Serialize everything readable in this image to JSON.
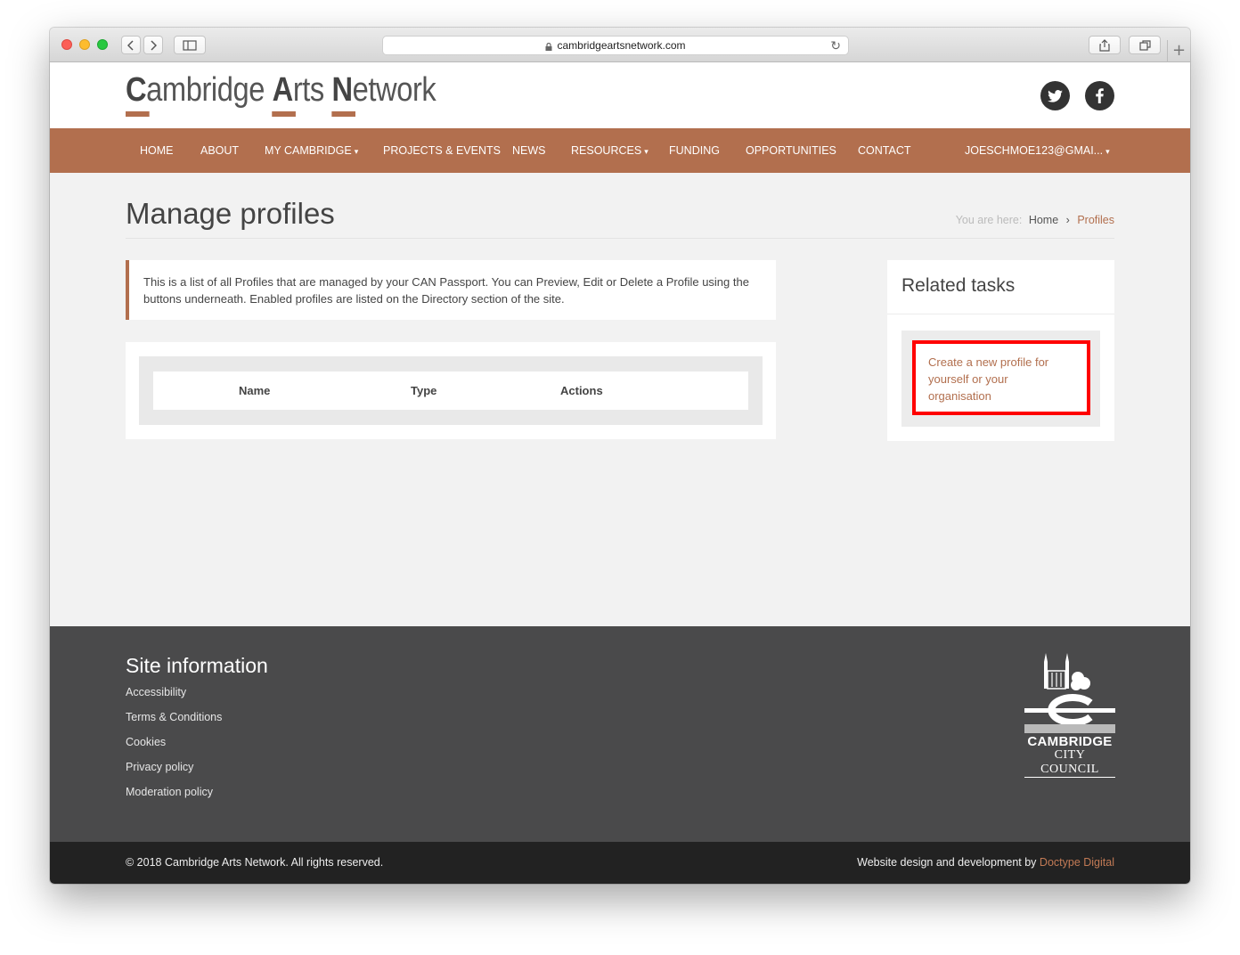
{
  "browser": {
    "url": "cambridgeartsnetwork.com"
  },
  "site": {
    "logo": {
      "c": "C",
      "ambridge": "ambridge",
      "a": "A",
      "rts": "rts",
      "n": "N",
      "etwork": "etwork"
    },
    "social": [
      {
        "icon": "twitter-icon"
      },
      {
        "icon": "facebook-icon"
      }
    ]
  },
  "nav": {
    "items": [
      {
        "label": "HOME",
        "dropdown": false
      },
      {
        "label": "ABOUT",
        "dropdown": false
      },
      {
        "label": "MY CAMBRIDGE",
        "dropdown": true
      },
      {
        "label": "PROJECTS & EVENTS",
        "dropdown": false
      },
      {
        "label": "NEWS",
        "dropdown": false
      },
      {
        "label": "RESOURCES",
        "dropdown": true
      },
      {
        "label": "FUNDING",
        "dropdown": false
      },
      {
        "label": "OPPORTUNITIES",
        "dropdown": false
      },
      {
        "label": "CONTACT",
        "dropdown": false
      }
    ],
    "account": "JOESCHMOE123@GMAI..."
  },
  "page": {
    "title": "Manage profiles",
    "breadcrumb": {
      "label": "You are here:",
      "home": "Home",
      "separator": "›",
      "current": "Profiles"
    },
    "notice": "This is a list of all Profiles that are managed by your CAN Passport. You can Preview, Edit or Delete a Profile using the buttons underneath. Enabled profiles are listed on the Directory section of the site.",
    "table": {
      "columns": [
        "Name",
        "Type",
        "Actions"
      ]
    }
  },
  "sidebar": {
    "title": "Related tasks",
    "task_link": "Create a new profile for yourself or your organisation"
  },
  "footer": {
    "title": "Site information",
    "links": [
      "Accessibility",
      "Terms & Conditions",
      "Cookies",
      "Privacy policy",
      "Moderation policy"
    ],
    "council": {
      "line1": "CAMBRIDGE",
      "line2": "CITY COUNCIL"
    },
    "copyright": "© 2018 Cambridge Arts Network. All rights reserved.",
    "credit_text": "Website design and development by",
    "credit_link": "Doctype Digital"
  },
  "colors": {
    "brand": "#b26f4e",
    "footer": "#4a4a4b",
    "bottom_bar": "#222222",
    "highlight": "#ff0000"
  }
}
